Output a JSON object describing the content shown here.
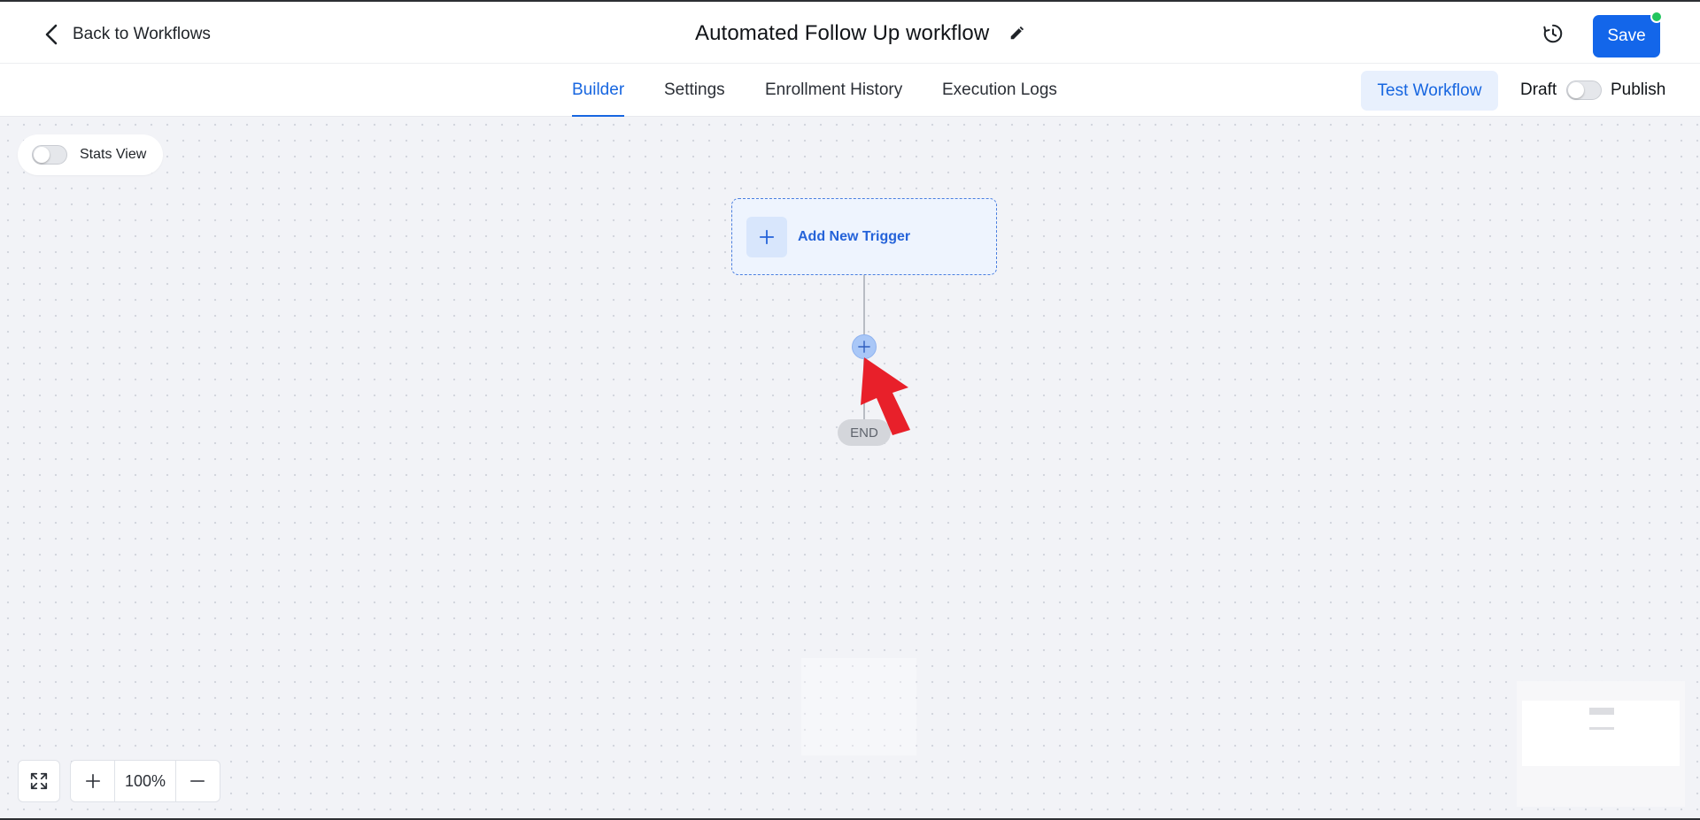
{
  "header": {
    "back_label": "Back to Workflows",
    "workflow_title": "Automated Follow Up workflow",
    "save_label": "Save"
  },
  "tabs": [
    {
      "label": "Builder",
      "active": true
    },
    {
      "label": "Settings",
      "active": false
    },
    {
      "label": "Enrollment History",
      "active": false
    },
    {
      "label": "Execution Logs",
      "active": false
    }
  ],
  "actions": {
    "test_label": "Test Workflow",
    "draft_label": "Draft",
    "publish_label": "Publish",
    "publish_on": false
  },
  "canvas": {
    "stats_view_label": "Stats View",
    "stats_view_on": false,
    "trigger_label": "Add New Trigger",
    "end_label": "END",
    "zoom_level": "100%"
  },
  "colors": {
    "primary": "#1366ea",
    "accent_text": "#1766e0",
    "status_dot": "#22c55e",
    "pointer_arrow": "#e8202a"
  },
  "icons": {
    "back": "chevron-left-icon",
    "edit": "pencil-icon",
    "history": "history-clock-icon",
    "fit": "fit-screen-icon",
    "zoom_in": "plus-icon",
    "zoom_out": "minus-icon"
  }
}
